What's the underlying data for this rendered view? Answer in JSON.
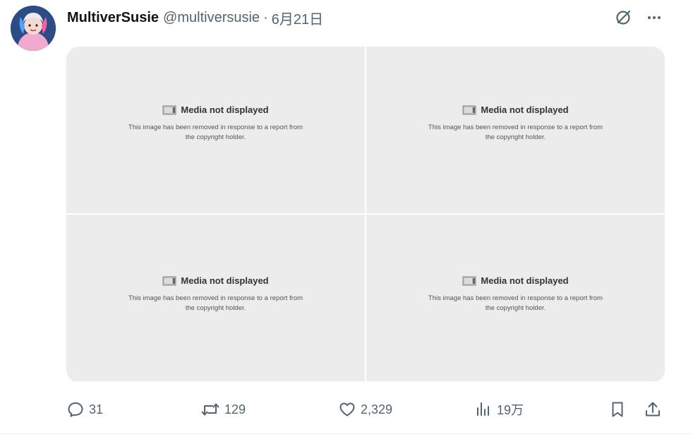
{
  "post": {
    "author": {
      "display_name": "MultiverSusie",
      "handle": "@multiversusie",
      "separator": "·",
      "date": "6月21日",
      "avatar_icon": "profile-avatar"
    },
    "top_actions": [
      {
        "icon": "grok-slash-circle-icon"
      },
      {
        "icon": "more-dots-icon",
        "label": "···"
      }
    ],
    "media": [
      {
        "title": "Media not displayed",
        "body": "This image has been removed in response to a report from the copyright holder."
      },
      {
        "title": "Media not displayed",
        "body": "This image has been removed in response to a report from the copyright holder."
      },
      {
        "title": "Media not displayed",
        "body": "This image has been removed in response to a report from the copyright holder."
      },
      {
        "title": "Media not displayed",
        "body": "This image has been removed in response to a report from the copyright holder."
      }
    ],
    "actions": {
      "reply": {
        "icon": "reply-icon",
        "count": "31"
      },
      "retweet": {
        "icon": "retweet-icon",
        "count": "129"
      },
      "like": {
        "icon": "heart-icon",
        "count": "2,329"
      },
      "views": {
        "icon": "views-bar-chart-icon",
        "count": "19万"
      },
      "bookmark": {
        "icon": "bookmark-icon"
      },
      "share": {
        "icon": "share-upload-icon"
      }
    },
    "colors": {
      "text_primary": "#0f1419",
      "text_secondary": "#536471",
      "media_placeholder": "#ececec"
    }
  }
}
